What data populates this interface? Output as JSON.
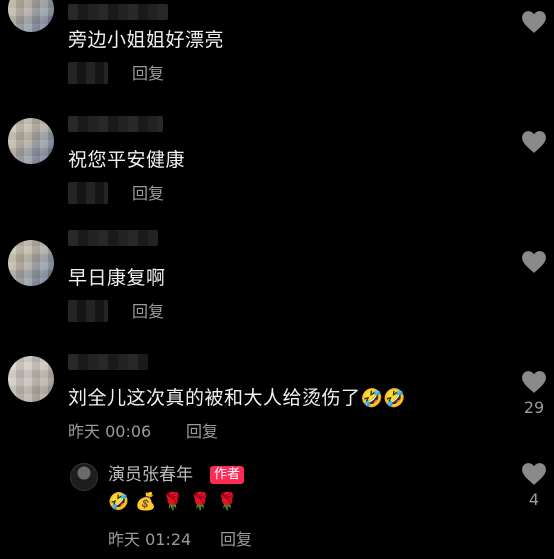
{
  "comments": [
    {
      "text": "旁边小姐姐好漂亮",
      "reply_label": "回复"
    },
    {
      "text": "祝您平安健康",
      "reply_label": "回复"
    },
    {
      "text": "早日康复啊",
      "reply_label": "回复"
    },
    {
      "text": "刘全儿这次真的被和大人给烫伤了",
      "text_emoji": "🤣🤣",
      "time": "昨天 00:06",
      "reply_label": "回复",
      "like_count": "29"
    }
  ],
  "author_reply": {
    "name": "演员张春年",
    "badge": "作者",
    "emoji_line": "🤣💰🌹🌹🌹",
    "time": "昨天 01:24",
    "reply_label": "回复",
    "like_count": "4"
  },
  "colors": {
    "background": "#000000",
    "text": "#f2f2f2",
    "meta": "#9b9b9b",
    "author_badge": "#fe2c55",
    "heart": "#8a8a8a"
  },
  "icons": {
    "like": "heart-icon"
  }
}
